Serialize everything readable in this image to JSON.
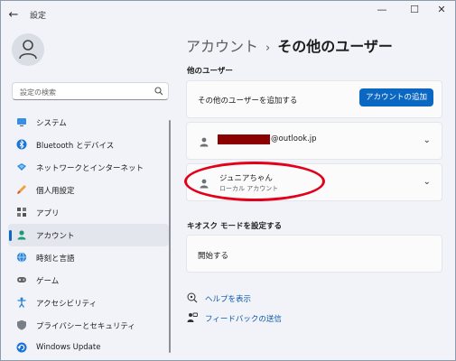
{
  "window": {
    "title": "設定",
    "controls": [
      "—",
      "☐",
      "✕"
    ]
  },
  "search": {
    "placeholder": "設定の検索"
  },
  "sidebar": {
    "items": [
      {
        "label": "システム",
        "icon": "system-icon"
      },
      {
        "label": "Bluetooth とデバイス",
        "icon": "bluetooth-icon"
      },
      {
        "label": "ネットワークとインターネット",
        "icon": "network-icon"
      },
      {
        "label": "個人用設定",
        "icon": "brush-icon"
      },
      {
        "label": "アプリ",
        "icon": "apps-icon"
      },
      {
        "label": "アカウント",
        "icon": "account-icon",
        "active": true
      },
      {
        "label": "時刻と言語",
        "icon": "globe-icon"
      },
      {
        "label": "ゲーム",
        "icon": "game-icon"
      },
      {
        "label": "アクセシビリティ",
        "icon": "accessibility-icon"
      },
      {
        "label": "プライバシーとセキュリティ",
        "icon": "shield-icon"
      },
      {
        "label": "Windows Update",
        "icon": "update-icon"
      }
    ]
  },
  "main": {
    "breadcrumb_parent": "アカウント",
    "breadcrumb_sep": "›",
    "breadcrumb_current": "その他のユーザー",
    "other_users_heading": "他のユーザー",
    "add_user_text": "その他のユーザーを追加する",
    "add_account_button": "アカウントの追加",
    "user1_email_suffix": "@outlook.jp",
    "user2_name": "ジュニアちゃん",
    "user2_type": "ローカル アカウント",
    "kiosk_heading": "キオスク モードを設定する",
    "kiosk_card_text": "開始する",
    "help_link": "ヘルプを表示",
    "feedback_link": "フィードバックの送信"
  },
  "colors": {
    "accent": "#0a67c2",
    "annotation": "#e3001b",
    "redaction": "#8b0000"
  }
}
